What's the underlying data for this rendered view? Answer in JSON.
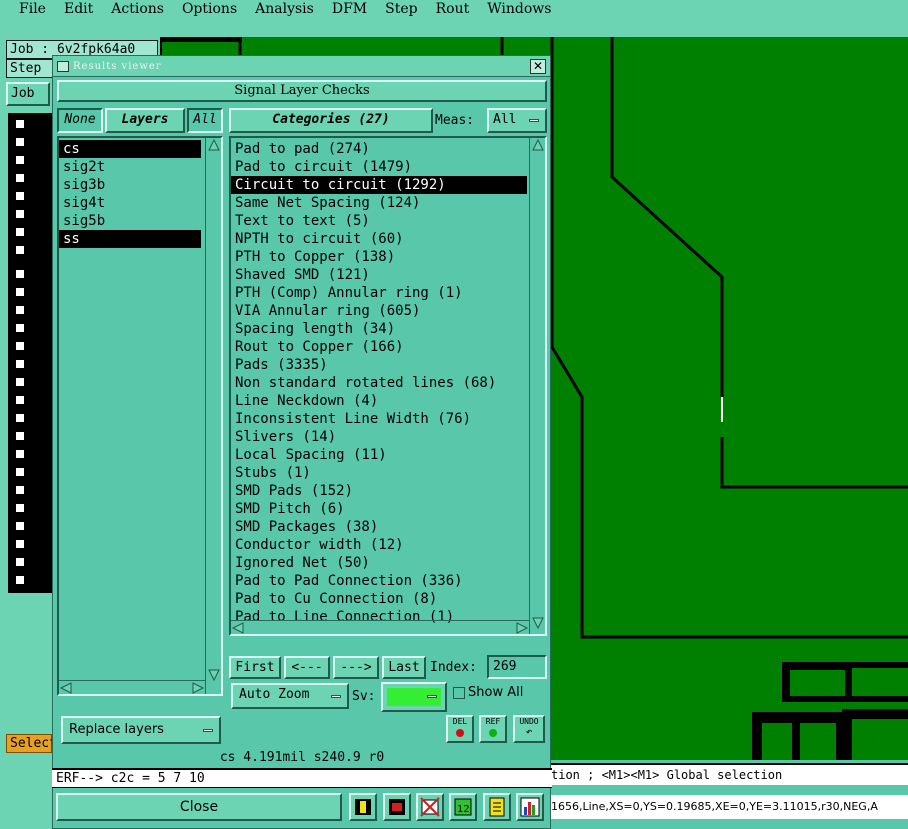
{
  "menu": [
    "File",
    "Edit",
    "Actions",
    "Options",
    "Analysis",
    "DFM",
    "Step",
    "Rout",
    "Windows"
  ],
  "toolkit": {
    "job_label": "Job : 6v2fpk64a0",
    "step_label": "Step",
    "job_button": "Job",
    "select_label": "Select"
  },
  "window": {
    "title": "Results viewer",
    "header": "Signal Layer Checks",
    "layers_panel": {
      "none_label": "None",
      "layers_label": "Layers",
      "all_label": "All",
      "items": [
        "cs",
        "sig2t",
        "sig3b",
        "sig4t",
        "sig5b",
        "ss"
      ],
      "selected": [
        "cs",
        "ss"
      ],
      "replace_label": "Replace layers"
    },
    "categories_panel": {
      "label": "Categories (27)",
      "meas_label": "Meas:",
      "meas_value": "All",
      "items": [
        "Pad to pad (274)",
        "Pad to circuit (1479)",
        "Circuit to circuit (1292)",
        "Same Net Spacing (124)",
        "Text to text (5)",
        "NPTH to circuit (60)",
        "PTH to Copper (138)",
        "Shaved SMD (121)",
        "PTH (Comp) Annular ring (1)",
        "VIA Annular ring (605)",
        "Spacing length (34)",
        "Rout to Copper (166)",
        "Pads (3335)",
        "Non standard rotated lines (68)",
        "Line Neckdown (4)",
        "Inconsistent Line Width (76)",
        "Slivers (14)",
        "Local Spacing (11)",
        "Stubs (1)",
        "SMD Pads (152)",
        "SMD Pitch (6)",
        "SMD Packages (38)",
        "Conductor width (12)",
        "Ignored Net (50)",
        "Pad to Pad Connection (336)",
        "Pad to Cu Connection (8)",
        "Pad to Line Connection (1)"
      ],
      "selected": "Circuit to circuit (1292)"
    },
    "nav": {
      "first": "First",
      "prev": "<---",
      "next": "--->",
      "last": "Last",
      "index_label": "Index:",
      "index_value": "269"
    },
    "auto_zoom_label": "Auto Zoom",
    "sv_label": "Sv:",
    "sv_color": "#33ee33",
    "show_all_label": "Show All",
    "action_icons": [
      "DEL",
      "REF",
      "UNDO"
    ],
    "status": "cs 4.191mil   s240.9   r0",
    "erf": "ERF--> c2c = 5 7 10",
    "close_label": "Close"
  },
  "bottom": {
    "message": "tion ; <M1><M1> Global selection",
    "coords": "1656,Line,XS=0,YS=0.19685,XE=0,YE=3.11015,r30,NEG,A"
  },
  "colors": {
    "panel": "#59c7a9",
    "panel_light": "#6cd3b3",
    "canvas_green": "#008000",
    "selection": "#000000"
  }
}
